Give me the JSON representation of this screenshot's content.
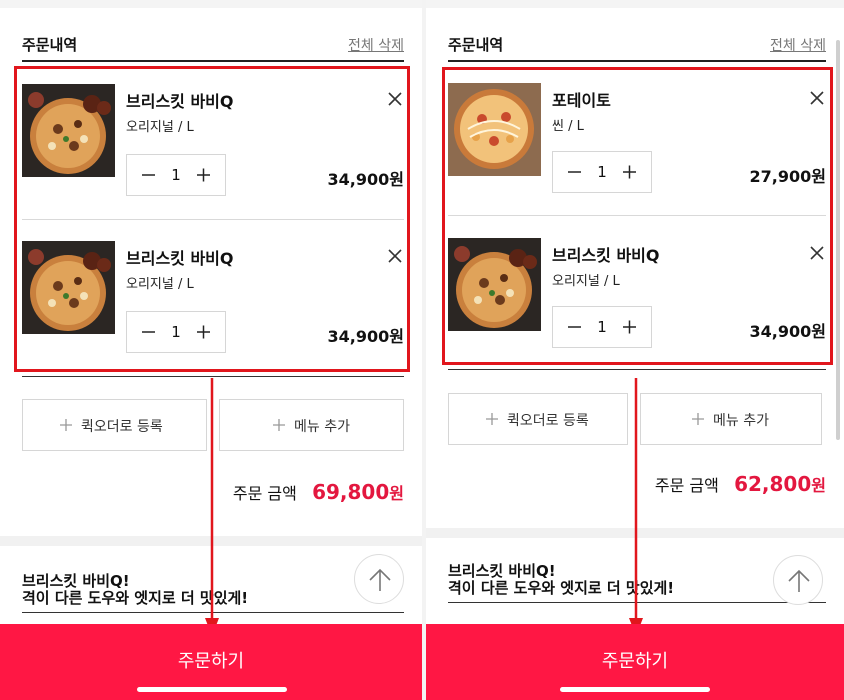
{
  "left": {
    "header": {
      "title": "주문내역",
      "delete_all": "전체 삭제"
    },
    "items": [
      {
        "name": "브리스킷 바비Q",
        "option": "오리지널 / L",
        "qty": "1",
        "price": "34,900원",
        "pizza_icon": "bbq-pizza-icon"
      },
      {
        "name": "브리스킷 바비Q",
        "option": "오리지널 / L",
        "qty": "1",
        "price": "34,900원",
        "pizza_icon": "bbq-pizza-icon"
      }
    ],
    "buttons": {
      "quick_order": "퀵오더로 등록",
      "add_menu": "메뉴 추가"
    },
    "total": {
      "label": "주문 금액",
      "value": "69,800",
      "unit": "원"
    },
    "promo": {
      "line1": "브리스킷 바비Q!",
      "line2": "격이 다른 도우와 엣지로 더 맛있게!"
    },
    "order_button": "주문하기"
  },
  "right": {
    "header": {
      "title": "주문내역",
      "delete_all": "전체 삭제"
    },
    "items": [
      {
        "name": "포테이토",
        "option": "씬 / L",
        "qty": "1",
        "price": "27,900원",
        "pizza_icon": "potato-pizza-icon"
      },
      {
        "name": "브리스킷 바비Q",
        "option": "오리지널 / L",
        "qty": "1",
        "price": "34,900원",
        "pizza_icon": "bbq-pizza-icon"
      }
    ],
    "buttons": {
      "quick_order": "퀵오더로 등록",
      "add_menu": "메뉴 추가"
    },
    "total": {
      "label": "주문 금액",
      "value": "62,800",
      "unit": "원"
    },
    "promo": {
      "line1": "브리스킷 바비Q!",
      "line2": "격이 다른 도우와 엣지로 더 맛있게!"
    },
    "order_button": "주문하기"
  },
  "colors": {
    "accent": "#ff1744",
    "price_red": "#e3173f",
    "annotation_red": "#e1161d"
  }
}
